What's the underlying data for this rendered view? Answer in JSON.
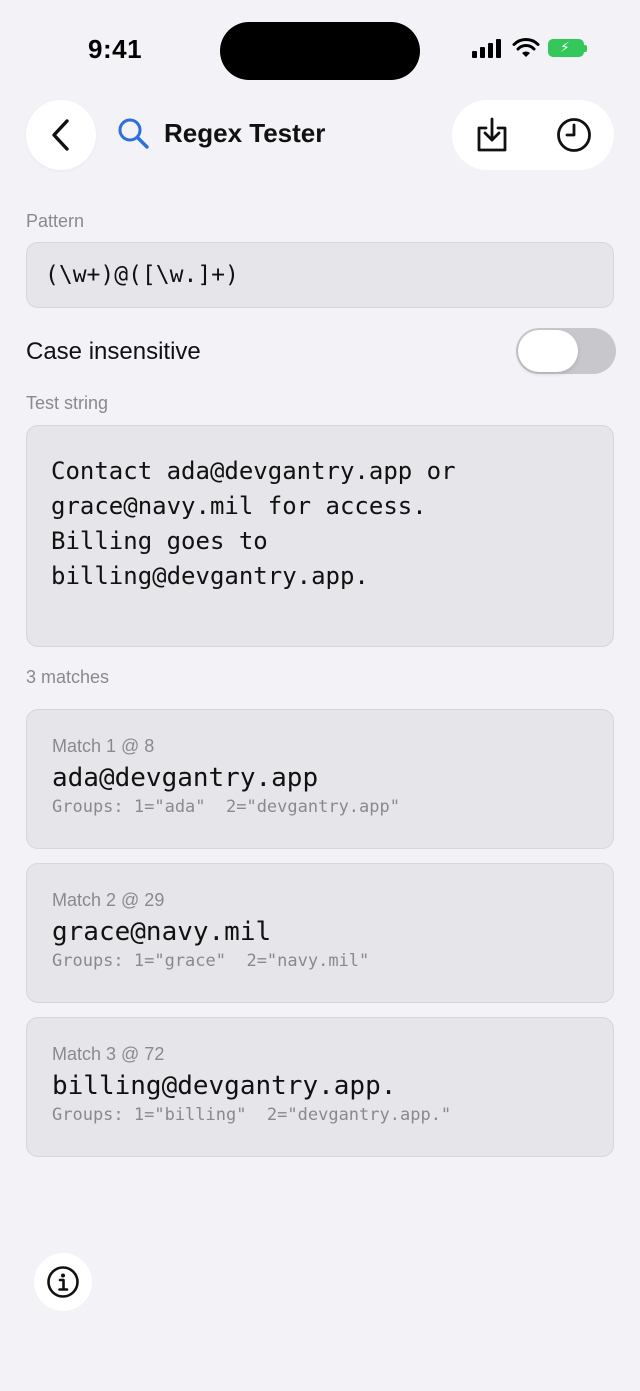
{
  "status_bar": {
    "time": "9:41"
  },
  "header": {
    "title": "Regex Tester"
  },
  "pattern": {
    "label": "Pattern",
    "value": "(\\w+)@([\\w.]+)"
  },
  "options": {
    "case_insensitive_label": "Case insensitive",
    "case_insensitive_on": false
  },
  "test_string": {
    "label": "Test string",
    "value": "Contact ada@devgantry.app or\ngrace@navy.mil for access.\nBilling goes to\nbilling@devgantry.app."
  },
  "results": {
    "count_label": "3 matches",
    "matches": [
      {
        "header": "Match 1 @ 8",
        "text": "ada@devgantry.app",
        "groups": "Groups: 1=\"ada\"  2=\"devgantry.app\""
      },
      {
        "header": "Match 2 @ 29",
        "text": "grace@navy.mil",
        "groups": "Groups: 1=\"grace\"  2=\"navy.mil\""
      },
      {
        "header": "Match 3 @ 72",
        "text": "billing@devgantry.app.",
        "groups": "Groups: 1=\"billing\"  2=\"devgantry.app.\""
      }
    ]
  },
  "colors": {
    "accent": "#2f6fdc",
    "battery": "#34c759",
    "field_bg": "#e5e5ea",
    "page_bg": "#f2f2f7"
  },
  "icons": {
    "back": "chevron-left-icon",
    "title": "search-icon",
    "export": "download-tray-icon",
    "history": "clock-icon",
    "info": "info-icon"
  }
}
